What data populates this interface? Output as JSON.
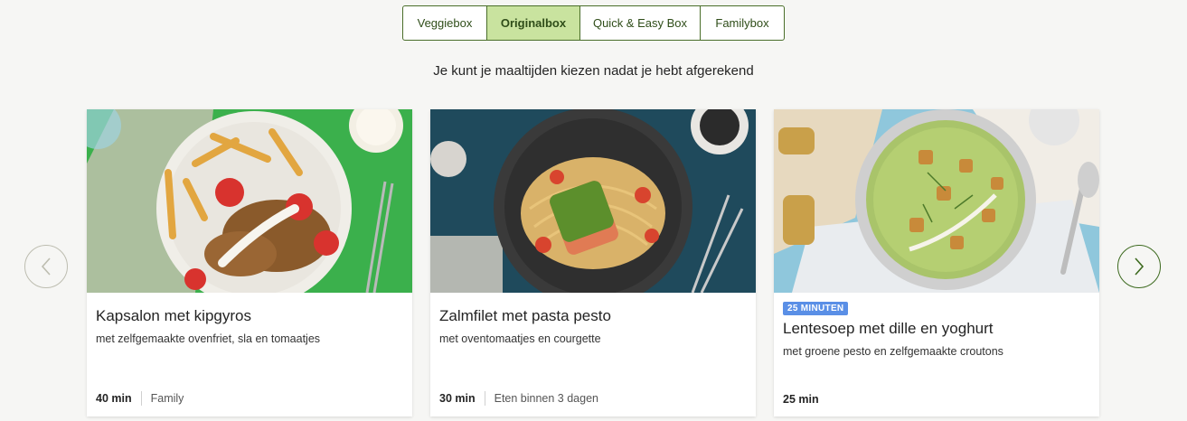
{
  "tabs": [
    {
      "label": "Veggiebox",
      "active": false
    },
    {
      "label": "Originalbox",
      "active": true
    },
    {
      "label": "Quick & Easy Box",
      "active": false
    },
    {
      "label": "Familybox",
      "active": false
    }
  ],
  "subtitle": "Je kunt je maaltijden kiezen nadat je hebt afgerekend",
  "cards": [
    {
      "title": "Kapsalon met kipgyros",
      "description": "met zelfgemaakte ovenfriet, sla en tomaatjes",
      "time": "40 min",
      "tag": "Family",
      "badge": ""
    },
    {
      "title": "Zalmfilet met pasta pesto",
      "description": "met oventomaatjes en courgette",
      "time": "30 min",
      "tag": "Eten binnen 3 dagen",
      "badge": ""
    },
    {
      "title": "Lentesoep met dille en yoghurt",
      "description": "met groene pesto en zelfgemaakte croutons",
      "time": "25 min",
      "tag": "",
      "badge": "25 MINUTEN"
    }
  ],
  "colors": {
    "accent": "#c9e39f",
    "brand_green": "#3d6a1f",
    "badge_blue": "#5a8fe6"
  },
  "icons": {
    "prev": "chevron-left-icon",
    "next": "chevron-right-icon"
  }
}
